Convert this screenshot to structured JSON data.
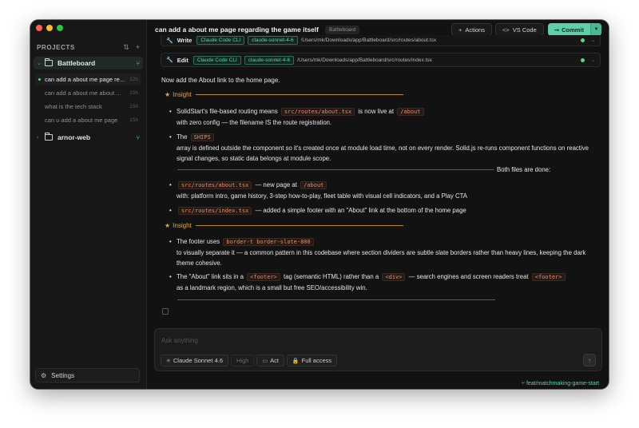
{
  "sidebar": {
    "projects_title": "PROJECTS",
    "projects": [
      {
        "name": "Battleboard",
        "expanded": true,
        "sessions": [
          {
            "title": "can add a about me page re...",
            "time": "12h",
            "active": true
          },
          {
            "title": "can add a about me  about ...",
            "time": "15h"
          },
          {
            "title": "what is the tech stack",
            "time": "15h"
          },
          {
            "title": "can u add a about me page",
            "time": "15h"
          }
        ]
      },
      {
        "name": "arnor-web",
        "expanded": false,
        "sessions": []
      }
    ],
    "settings_label": "Settings"
  },
  "header": {
    "title": "can add a about me page regarding the game itself",
    "badge": "Battleboard",
    "actions_label": "Actions",
    "vscode_label": "VS Code",
    "commit_label": "Commit"
  },
  "tools": [
    {
      "name": "Write",
      "tag1": "Claude Code CLI",
      "tag2": "claude-sonnet-4-6",
      "path": "/Users/mk/Downloads/app/Battleboard/src/routes/about.tsx"
    },
    {
      "name": "Edit",
      "tag1": "Claude Code CLI",
      "tag2": "claude-sonnet-4-6",
      "path": "/Users/mk/Downloads/app/Battleboard/src/routes/index.tsx"
    }
  ],
  "message": {
    "intro": "Now add the About link to the home page.",
    "insight_label": "Insight",
    "b1": {
      "pre": "SolidStart's file-based routing means",
      "code": "src/routes/about.tsx",
      "mid": "is now live at",
      "code2": "/about",
      "post": "with zero config — the filename IS the route registration."
    },
    "b2": {
      "pre": "The",
      "code": "SHIPS",
      "post": "array is defined outside the component so it's created once at module load time, not on every render. Solid.js re-runs component functions on reactive signal changes, so static data belongs at module scope."
    },
    "both_done": "Both files are done:",
    "b3": {
      "code": "src/routes/about.tsx",
      "mid": "— new page at",
      "code2": "/about",
      "post": "with: platform intro, game history, 3-step how-to-play, fleet table with visual cell indicators, and a Play CTA"
    },
    "b4": {
      "code": "src/routes/index.tsx",
      "post": "— added a simple footer with an \"About\" link at the bottom of the home page"
    },
    "b5": {
      "pre": "The footer uses",
      "code": "border-t border-slate-800",
      "post": "to visually separate it — a common pattern in this codebase where section dividers are subtle slate borders rather than heavy lines, keeping the dark theme cohesive."
    },
    "b6": {
      "pre": "The \"About\" link sits in a",
      "code": "<footer>",
      "mid": "tag (semantic HTML) rather than a",
      "code2": "<div>",
      "mid2": "— search engines and screen readers treat",
      "code3": "<footer>",
      "post": "as a landmark region, which is a small but free SEO/accessibility win."
    }
  },
  "composer": {
    "placeholder": "Ask anything",
    "model": "Claude Sonnet 4.6",
    "effort": "High",
    "mode": "Act",
    "access": "Full access"
  },
  "branch": "feat/matchmaking-game-start"
}
